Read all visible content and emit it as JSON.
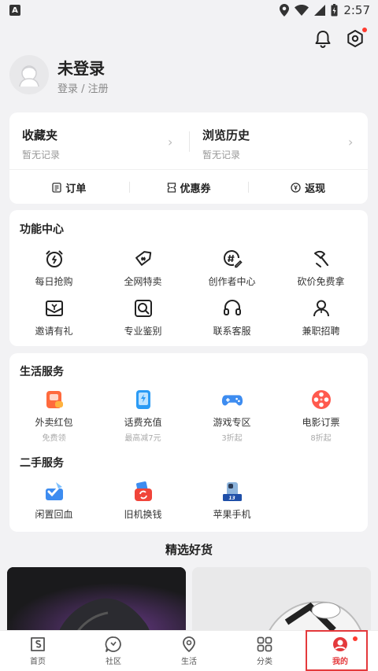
{
  "status_bar": {
    "time": "2:57",
    "app_icon": "A"
  },
  "header": {
    "title": "未登录",
    "subtitle": "登录 / 注册",
    "icons": [
      "bell-icon",
      "settings-icon"
    ]
  },
  "favorites": {
    "left": {
      "title": "收藏夹",
      "subtitle": "暂无记录"
    },
    "right": {
      "title": "浏览历史",
      "subtitle": "暂无记录"
    },
    "orders": [
      {
        "label": "订单",
        "icon": "order-icon"
      },
      {
        "label": "优惠券",
        "icon": "coupon-icon"
      },
      {
        "label": "返现",
        "icon": "cashback-icon"
      }
    ]
  },
  "features": {
    "title": "功能中心",
    "items": [
      {
        "label": "每日抢购",
        "icon": "alarm-clock-icon"
      },
      {
        "label": "全网特卖",
        "icon": "price-tag-icon"
      },
      {
        "label": "创作者中心",
        "icon": "hashtag-pen-icon"
      },
      {
        "label": "砍价免费拿",
        "icon": "axe-icon"
      },
      {
        "label": "邀请有礼",
        "icon": "gift-envelope-icon"
      },
      {
        "label": "专业鉴别",
        "icon": "magnify-check-icon"
      },
      {
        "label": "联系客服",
        "icon": "headset-icon"
      },
      {
        "label": "兼职招聘",
        "icon": "person-icon"
      }
    ]
  },
  "life_services": {
    "title": "生活服务",
    "items": [
      {
        "label": "外卖红包",
        "sub": "免费领",
        "icon": "food-coupon-icon"
      },
      {
        "label": "话费充值",
        "sub": "最高减7元",
        "icon": "phone-charge-icon"
      },
      {
        "label": "游戏专区",
        "sub": "3折起",
        "icon": "gamepad-icon"
      },
      {
        "label": "电影订票",
        "sub": "8折起",
        "icon": "film-reel-icon"
      }
    ]
  },
  "secondhand": {
    "title": "二手服务",
    "items": [
      {
        "label": "闲置回血",
        "icon": "idle-box-icon"
      },
      {
        "label": "旧机换钱",
        "icon": "phone-trade-icon"
      },
      {
        "label": "苹果手机",
        "icon": "iphone-icon",
        "badge": "13 NEW"
      }
    ]
  },
  "picks": {
    "title": "精选好货"
  },
  "nav": [
    {
      "label": "首页",
      "icon": "home-icon"
    },
    {
      "label": "社区",
      "icon": "community-icon"
    },
    {
      "label": "生活",
      "icon": "location-icon"
    },
    {
      "label": "分类",
      "icon": "grid-icon"
    },
    {
      "label": "我的",
      "icon": "profile-icon",
      "active": true
    }
  ],
  "colors": {
    "accent": "#e4393c",
    "background": "#f2f2f4"
  }
}
